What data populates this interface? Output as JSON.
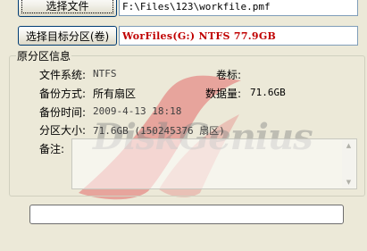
{
  "top": {
    "select_file_label": "选择文件",
    "file_path": "F:\\Files\\123\\workfile.pmf",
    "select_target_label": "选择目标分区(卷)",
    "target_partition": "WorFiles(G:) NTFS 77.9GB"
  },
  "source_info": {
    "group_title": "原分区信息",
    "filesystem_label": "文件系统:",
    "filesystem_value": "NTFS",
    "volume_label_label": "卷标:",
    "volume_label_value": "",
    "backup_mode_label": "备份方式:",
    "backup_mode_value": "所有扇区",
    "data_size_label": "数据量:",
    "data_size_value": "71.6GB",
    "backup_time_label": "备份时间:",
    "backup_time_value": "2009-4-13 18:18",
    "partition_size_label": "分区大小:",
    "partition_size_value": "71.6GB  (150245376 扇区)",
    "notes_label": "备注:",
    "notes_value": ""
  },
  "progress": {
    "fraction": 0
  },
  "watermark": {
    "text": "DiskGenius"
  },
  "colors": {
    "window_bg": "#ece9d8",
    "partition_text": "#c00000",
    "watermark_red": "#e06060",
    "progress_fill": "#36b236"
  }
}
